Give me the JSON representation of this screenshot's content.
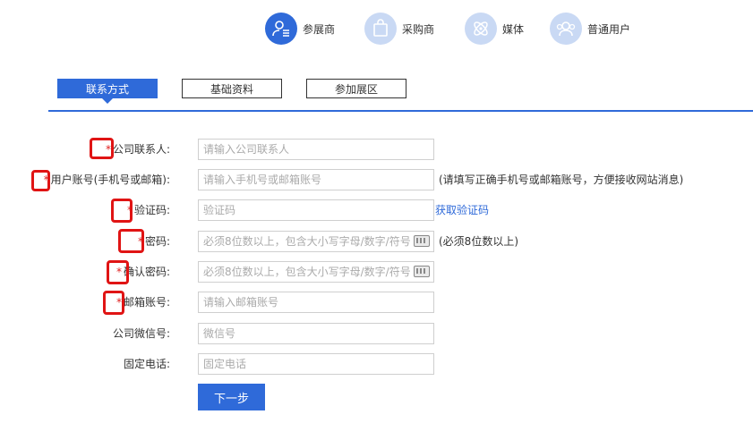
{
  "roles": [
    {
      "label": "参展商",
      "icon": "exhibitor-icon",
      "active": true
    },
    {
      "label": "采购商",
      "icon": "shopping-bag-icon",
      "active": false
    },
    {
      "label": "媒体",
      "icon": "media-icon",
      "active": false
    },
    {
      "label": "普通用户",
      "icon": "users-icon",
      "active": false
    }
  ],
  "tabs": [
    "联系方式",
    "基础资料",
    "参加展区"
  ],
  "required_mark": "*",
  "form": {
    "company_contact": {
      "label": "公司联系人:",
      "placeholder": "请输入公司联系人"
    },
    "account": {
      "label": "用户账号(手机号或邮箱):",
      "placeholder": "请输入手机号或邮箱账号",
      "hint": "(请填写正确手机号或邮箱账号，方便接收网站消息)"
    },
    "captcha": {
      "label": "验证码:",
      "placeholder": "验证码",
      "link": "获取验证码"
    },
    "password": {
      "label": "密码:",
      "placeholder": "必须8位数以上，包含大小写字母/数字/符号",
      "hint": "(必须8位数以上)"
    },
    "confirm_password": {
      "label": "确认密码:",
      "placeholder": "必须8位数以上，包含大小写字母/数字/符号"
    },
    "email": {
      "label": "邮箱账号:",
      "placeholder": "请输入邮箱账号"
    },
    "wechat": {
      "label": "公司微信号:",
      "placeholder": "微信号"
    },
    "phone": {
      "label": "固定电话:",
      "placeholder": "固定电话"
    }
  },
  "next_button": "下一步",
  "colors": {
    "primary": "#2f6ad9",
    "required": "#e02020",
    "marker": "#e01414"
  }
}
